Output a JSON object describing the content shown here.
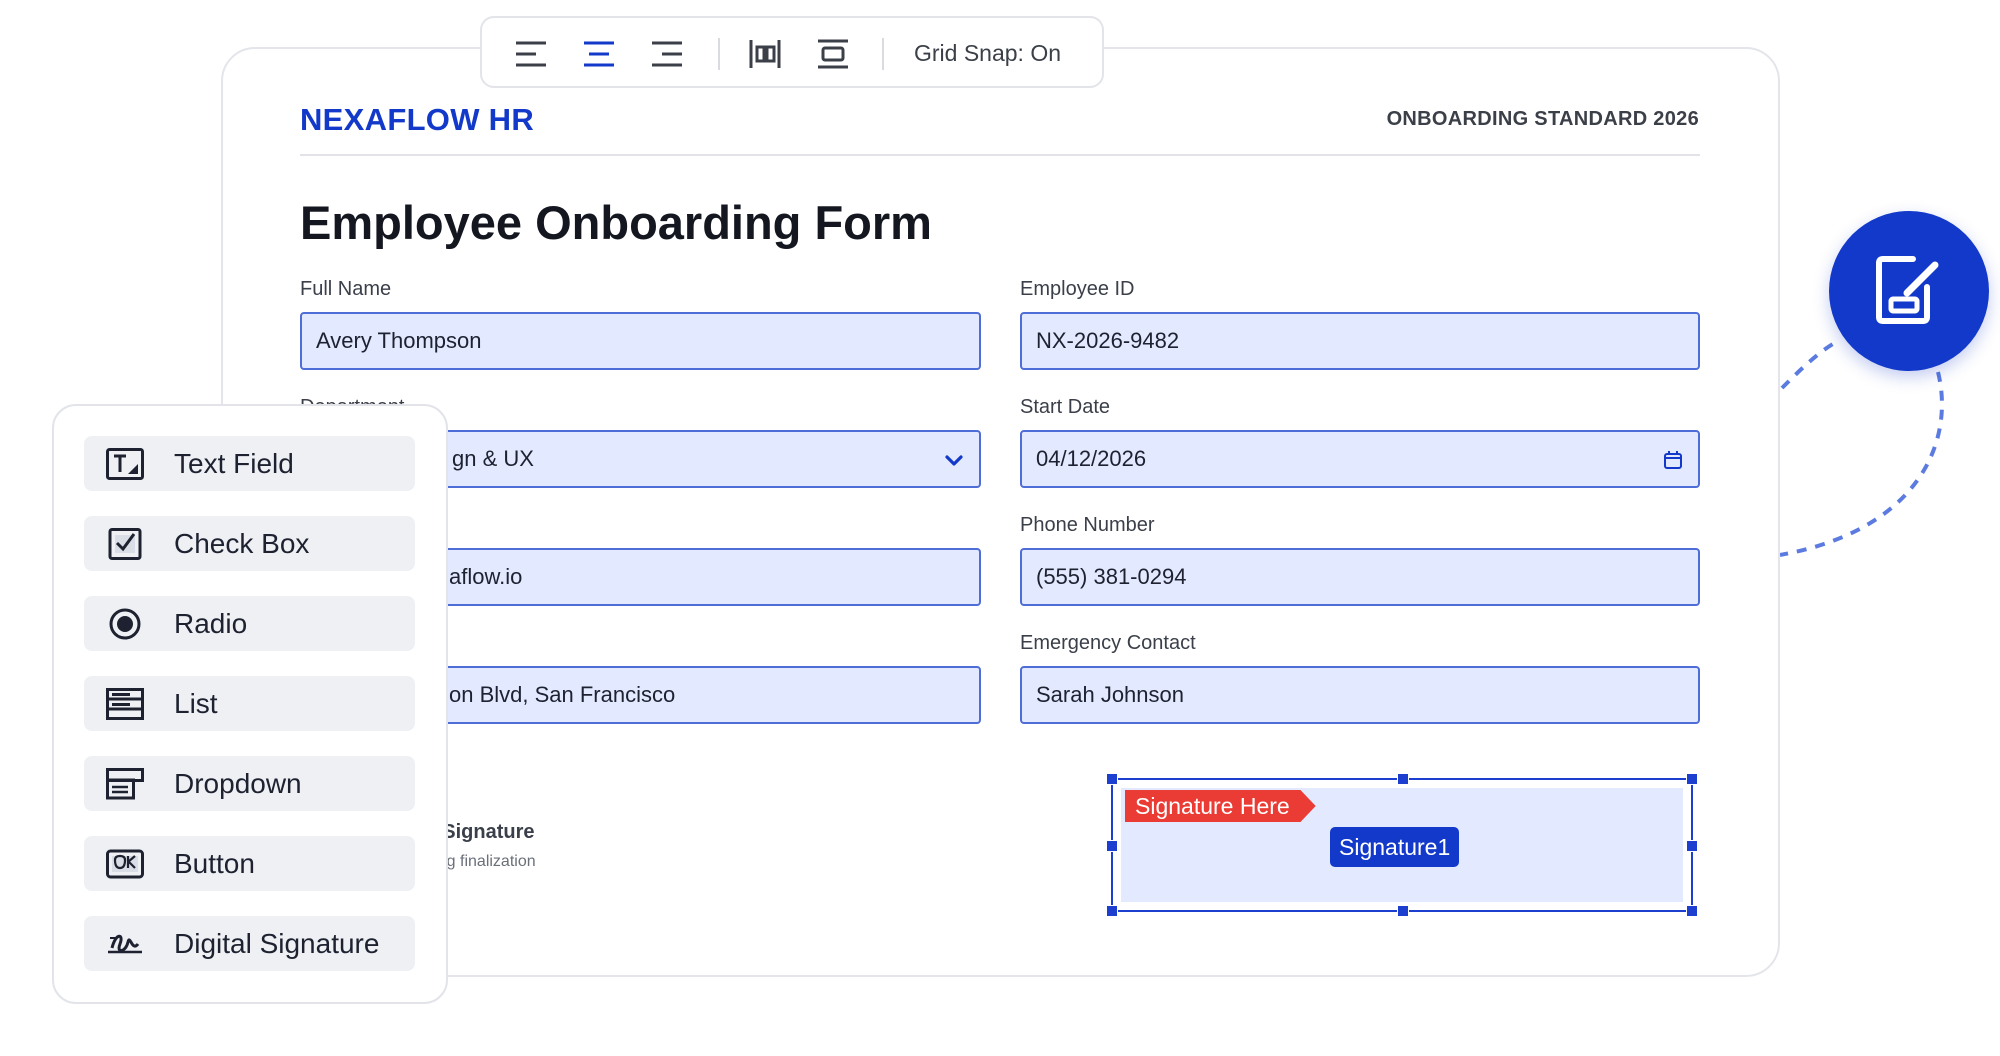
{
  "header": {
    "brand": "NEXAFLOW HR",
    "standard": "ONBOARDING STANDARD 2026",
    "title": "Employee Onboarding Form"
  },
  "form": {
    "full_name": {
      "label": "Full Name",
      "value": "Avery Thompson"
    },
    "employee_id": {
      "label": "Employee ID",
      "value": "NX-2026-9482"
    },
    "department": {
      "label": "Department",
      "value": "gn & UX"
    },
    "start_date": {
      "label": "Start Date",
      "value": "04/12/2026"
    },
    "email": {
      "value": "aflow.io"
    },
    "phone": {
      "label": "Phone Number",
      "value": "(555) 381-0294"
    },
    "address": {
      "value": "on Blvd, San Francisco"
    },
    "emergency": {
      "label": "Emergency Contact",
      "value": "Sarah Johnson"
    },
    "signature_section": {
      "label": "al Signature",
      "sub": "rding finalization"
    }
  },
  "signature_box": {
    "badge": "Signature Here",
    "field_name": "Signature1"
  },
  "toolbar": {
    "icons": [
      "align-left-icon",
      "align-center-icon",
      "align-right-icon",
      "distribute-horizontal-icon",
      "distribute-vertical-icon"
    ],
    "grid_snap": "Grid Snap: On"
  },
  "palette": {
    "items": [
      {
        "label": "Text Field",
        "icon": "text-field-icon"
      },
      {
        "label": "Check Box",
        "icon": "checkbox-icon"
      },
      {
        "label": "Radio",
        "icon": "radio-icon"
      },
      {
        "label": "List",
        "icon": "list-icon"
      },
      {
        "label": "Dropdown",
        "icon": "dropdown-icon"
      },
      {
        "label": "Button",
        "icon": "button-icon"
      },
      {
        "label": "Digital Signature",
        "icon": "digital-signature-icon"
      }
    ]
  },
  "colors": {
    "brand": "#1239c9",
    "field_bg": "#e3e9ff",
    "field_border": "#4f6dd6",
    "badge": "#ea3c35"
  }
}
